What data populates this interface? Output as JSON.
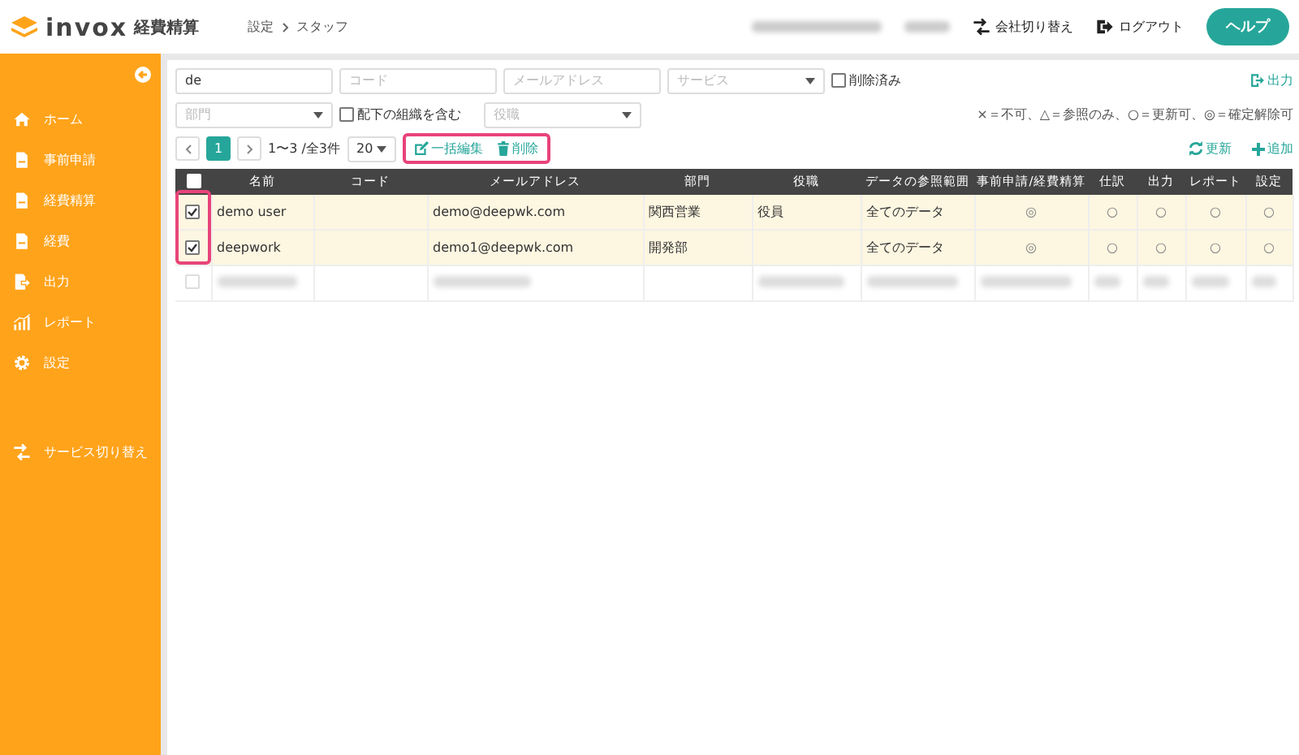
{
  "header": {
    "logo": "invox",
    "product": "経費精算",
    "breadcrumb": [
      "設定",
      "スタッフ"
    ],
    "switch_company": "会社切り替え",
    "logout": "ログアウト",
    "help": "ヘルプ"
  },
  "sidebar": {
    "items": [
      {
        "label": "ホーム",
        "kind": "home"
      },
      {
        "label": "事前申請",
        "kind": "doc"
      },
      {
        "label": "経費精算",
        "kind": "doc"
      },
      {
        "label": "経費",
        "kind": "doc"
      },
      {
        "label": "出力",
        "kind": "export"
      },
      {
        "label": "レポート",
        "kind": "chart"
      },
      {
        "label": "設定",
        "kind": "gear"
      }
    ],
    "service_switch": "サービス切り替え"
  },
  "filters": {
    "name": {
      "value": "de"
    },
    "code": {
      "placeholder": "コード"
    },
    "email": {
      "placeholder": "メールアドレス"
    },
    "service": {
      "placeholder": "サービス"
    },
    "deleted": {
      "label": "削除済み",
      "checked": false
    },
    "department": {
      "placeholder": "部門"
    },
    "include_sub": {
      "label": "配下の組織を含む",
      "checked": false
    },
    "position": {
      "placeholder": "役職"
    },
    "export": "出力"
  },
  "legend": "×＝不可、△＝参照のみ、○＝更新可、◎＝確定解除可",
  "pagination": {
    "pages": [
      {
        "label": "1",
        "selected": true
      }
    ],
    "summary": "1〜3 /全3件",
    "page_size": "20"
  },
  "bulk_actions": {
    "highlighted": true,
    "edit": "一括編集",
    "delete": "削除"
  },
  "refresh": "更新",
  "add": "追加",
  "table": {
    "header_checked": false,
    "checkbox_highlighted": true,
    "columns": [
      "名前",
      "コード",
      "メールアドレス",
      "部門",
      "役職",
      "データの参照範囲",
      "事前申請/経費精算",
      "仕訳",
      "出力",
      "レポート",
      "設定"
    ],
    "rows": [
      {
        "selected": true,
        "checked": true,
        "cells": [
          "demo user",
          "",
          "demo@deepwk.com",
          "関西営業",
          "役員",
          "全てのデータ",
          "◎",
          "○",
          "○",
          "○",
          "○"
        ]
      },
      {
        "selected": true,
        "checked": true,
        "cells": [
          "deepwork",
          "",
          "demo1@deepwk.com",
          "開発部",
          "",
          "全てのデータ",
          "◎",
          "○",
          "○",
          "○",
          "○"
        ]
      },
      {
        "selected": false,
        "checked": false,
        "cells": []
      }
    ]
  }
}
